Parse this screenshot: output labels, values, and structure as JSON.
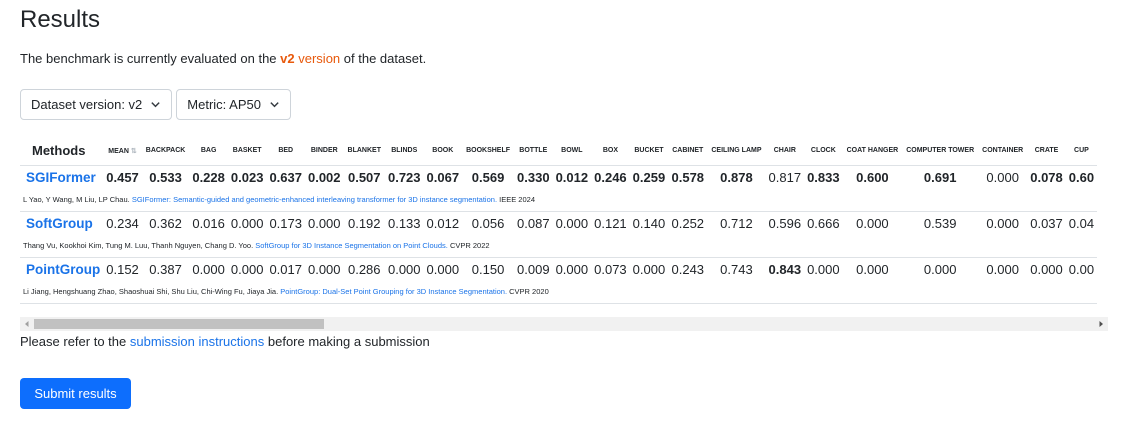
{
  "page": {
    "title": "Results",
    "intro_prefix": "The benchmark is currently evaluated on the",
    "intro_version": "v2",
    "intro_link": "version",
    "intro_suffix": "of the dataset."
  },
  "filters": {
    "dataset_version": "Dataset version: v2",
    "metric": "Metric: AP50"
  },
  "table": {
    "methods_header": "Methods",
    "columns": [
      "MEAN",
      "BACKPACK",
      "BAG",
      "BASKET",
      "BED",
      "BINDER",
      "BLANKET",
      "BLINDS",
      "BOOK",
      "BOOKSHELF",
      "BOTTLE",
      "BOWL",
      "BOX",
      "BUCKET",
      "CABINET",
      "CEILING LAMP",
      "CHAIR",
      "CLOCK",
      "COAT HANGER",
      "COMPUTER TOWER",
      "CONTAINER",
      "CRATE",
      "CUP"
    ],
    "sort_icon": "sort-icon",
    "rows": [
      {
        "name": "SGIFormer",
        "values": [
          "0.457",
          "0.533",
          "0.228",
          "0.023",
          "0.637",
          "0.002",
          "0.507",
          "0.723",
          "0.067",
          "0.569",
          "0.330",
          "0.012",
          "0.246",
          "0.259",
          "0.578",
          "0.878",
          "0.817",
          "0.833",
          "0.600",
          "0.691",
          "0.000",
          "0.078",
          "0.60"
        ],
        "bold": [
          true,
          true,
          true,
          true,
          true,
          true,
          true,
          true,
          true,
          true,
          true,
          true,
          true,
          true,
          true,
          true,
          false,
          true,
          true,
          true,
          false,
          true,
          true
        ],
        "authors": "L Yao, Y Wang, M Liu, LP Chau.",
        "paper": "SGIFormer: Semantic-guided and geometric-enhanced interleaving transformer for 3D instance segmentation.",
        "venue": "IEEE 2024"
      },
      {
        "name": "SoftGroup",
        "values": [
          "0.234",
          "0.362",
          "0.016",
          "0.000",
          "0.173",
          "0.000",
          "0.192",
          "0.133",
          "0.012",
          "0.056",
          "0.087",
          "0.000",
          "0.121",
          "0.140",
          "0.252",
          "0.712",
          "0.596",
          "0.666",
          "0.000",
          "0.539",
          "0.000",
          "0.037",
          "0.04"
        ],
        "bold": [
          false,
          false,
          false,
          false,
          false,
          false,
          false,
          false,
          false,
          false,
          false,
          false,
          false,
          false,
          false,
          false,
          false,
          false,
          false,
          false,
          false,
          false,
          false
        ],
        "authors": "Thang Vu, Kookhoi Kim, Tung M. Luu, Thanh Nguyen, Chang D. Yoo.",
        "paper": "SoftGroup for 3D Instance Segmentation on Point Clouds.",
        "venue": "CVPR 2022"
      },
      {
        "name": "PointGroup",
        "values": [
          "0.152",
          "0.387",
          "0.000",
          "0.000",
          "0.017",
          "0.000",
          "0.286",
          "0.000",
          "0.000",
          "0.150",
          "0.009",
          "0.000",
          "0.073",
          "0.000",
          "0.243",
          "0.743",
          "0.843",
          "0.000",
          "0.000",
          "0.000",
          "0.000",
          "0.000",
          "0.00"
        ],
        "bold": [
          false,
          false,
          false,
          false,
          false,
          false,
          false,
          false,
          false,
          false,
          false,
          false,
          false,
          false,
          false,
          false,
          true,
          false,
          false,
          false,
          false,
          false,
          false
        ],
        "authors": "Li Jiang, Hengshuang Zhao, Shaoshuai Shi, Shu Liu, Chi-Wing Fu, Jiaya Jia.",
        "paper": "PointGroup: Dual-Set Point Grouping for 3D Instance Segmentation.",
        "venue": "CVPR 2020"
      }
    ]
  },
  "footer": {
    "prefix": "Please refer to the",
    "link": "submission instructions",
    "suffix": "before making a submission",
    "submit_label": "Submit results"
  },
  "colors": {
    "accent": "#e8590c",
    "link": "#1a73e8",
    "primary_button": "#0d6efd"
  }
}
